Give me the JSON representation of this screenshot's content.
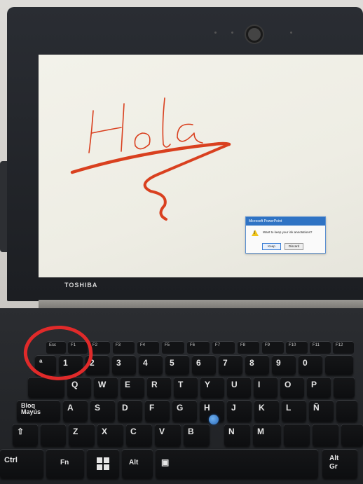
{
  "laptop": {
    "brand": "TOSHIBA"
  },
  "screen": {
    "annotation_colour": "#d9401f",
    "dialog": {
      "title": "Microsoft PowerPoint",
      "message": "Want to keep your ink annotations?",
      "keep_label": "Keep",
      "discard_label": "Discard"
    }
  },
  "keyboard": {
    "highlight_colour": "#e02a2a",
    "fkeys": [
      "Esc",
      "F1",
      "F2",
      "F3",
      "F4",
      "F5",
      "F6",
      "F7",
      "F8",
      "F9",
      "F10",
      "F11",
      "F12"
    ],
    "row_top_left": "ª",
    "num_row": [
      "1",
      "2",
      "3",
      "4",
      "5",
      "6",
      "7",
      "8",
      "9",
      "0"
    ],
    "q_row": [
      "Q",
      "W",
      "E",
      "R",
      "T",
      "Y",
      "U",
      "I",
      "O",
      "P"
    ],
    "caps_label": "Bloq Mayús",
    "a_row": [
      "A",
      "S",
      "D",
      "F",
      "G",
      "H",
      "J",
      "K",
      "L",
      "Ñ"
    ],
    "z_row": [
      "Z",
      "X",
      "C",
      "V",
      "B",
      "N",
      "M"
    ],
    "bottom": {
      "ctrl": "Ctrl",
      "fn": "Fn",
      "alt": "Alt",
      "altgr": "Alt Gr"
    }
  }
}
